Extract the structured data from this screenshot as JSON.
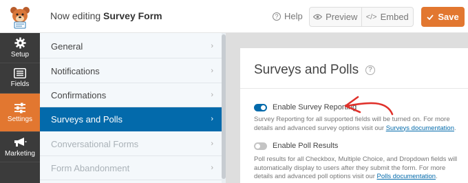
{
  "header": {
    "editing_prefix": "Now editing",
    "form_name": "Survey Form",
    "help_label": "Help",
    "preview_label": "Preview",
    "embed_label": "Embed",
    "save_label": "Save"
  },
  "leftnav": {
    "items": [
      {
        "label": "Setup",
        "icon": "gear-icon"
      },
      {
        "label": "Fields",
        "icon": "list-icon"
      },
      {
        "label": "Settings",
        "icon": "sliders-icon",
        "active": true
      },
      {
        "label": "Marketing",
        "icon": "megaphone-icon"
      }
    ]
  },
  "settings_menu": {
    "items": [
      {
        "label": "General"
      },
      {
        "label": "Notifications"
      },
      {
        "label": "Confirmations"
      },
      {
        "label": "Surveys and Polls",
        "active": true
      },
      {
        "label": "Conversational Forms",
        "disabled": true
      },
      {
        "label": "Form Abandonment",
        "disabled": true
      }
    ]
  },
  "panel": {
    "title": "Surveys and Polls",
    "survey_toggle": {
      "label": "Enable Survey Reporting",
      "enabled": true,
      "description": "Survey Reporting for all supported fields will be turned on. For more details and advanced survey options visit our",
      "link": "Surveys documentation"
    },
    "poll_toggle": {
      "label": "Enable Poll Results",
      "enabled": false,
      "description": "Poll results for all Checkbox, Multiple Choice, and Dropdown fields will automatically display to users after they submit the form. For more details and advanced poll options visit our",
      "link": "Polls documentation"
    }
  },
  "colors": {
    "accent_orange": "#e27730",
    "active_blue": "#036aab",
    "sidebar_dark": "#3b3b3b",
    "annotation_red": "#e0312b"
  }
}
